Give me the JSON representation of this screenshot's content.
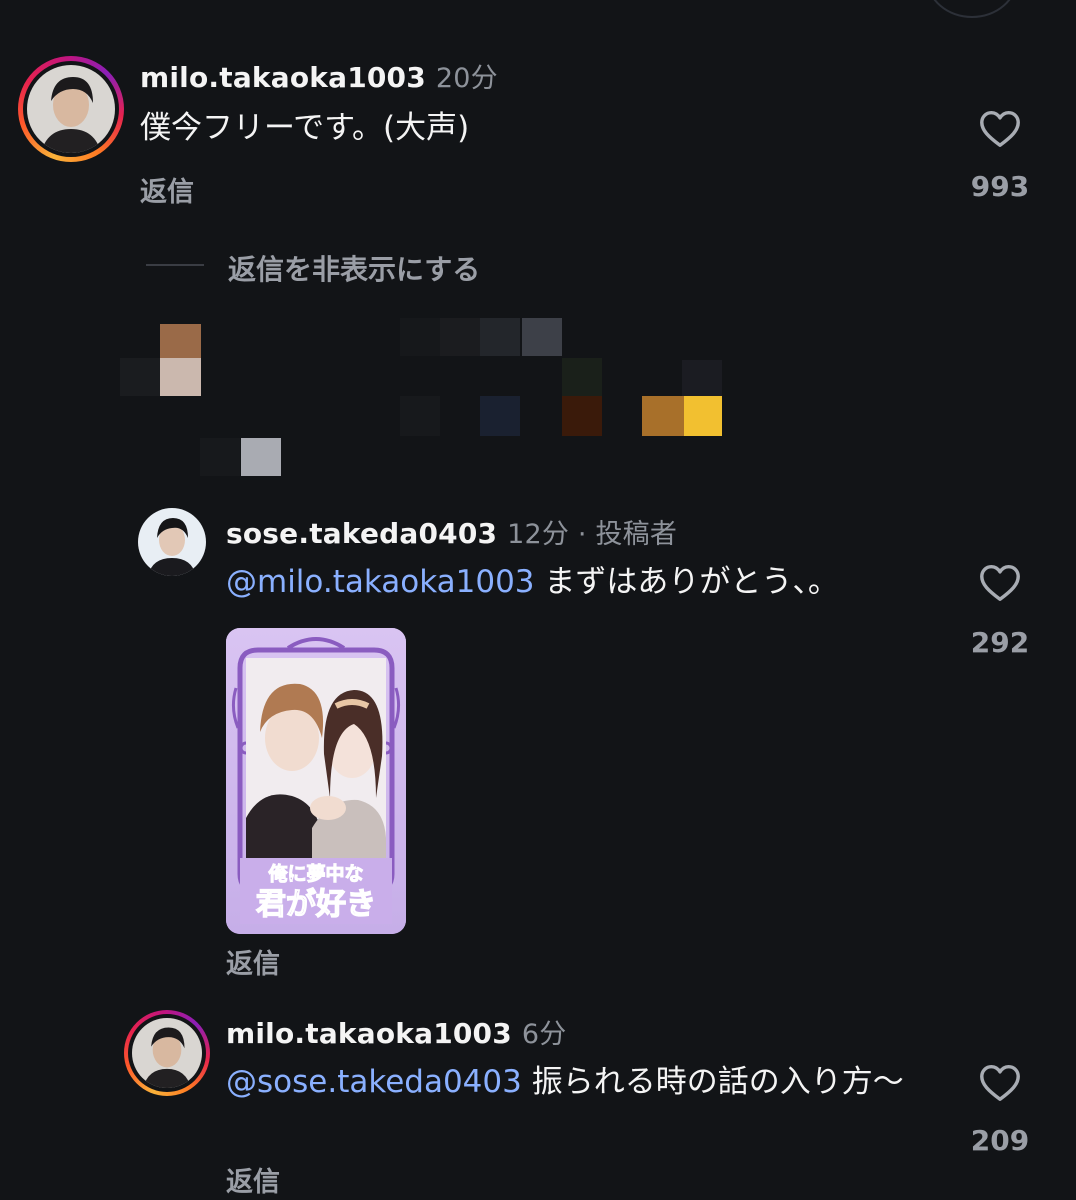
{
  "comment1": {
    "username": "milo.takaoka1003",
    "time": "20分",
    "text": "僕今フリーです。(大声)",
    "reply_label": "返信",
    "likes": "993"
  },
  "hide_replies": "返信を非表示にする",
  "reply1": {
    "username": "sose.takeda0403",
    "meta": "12分 · 投稿者",
    "mention": "@milo.takaoka1003",
    "text": " まずはありがとう、。",
    "reply_label": "返信",
    "likes": "292",
    "image_text_line1": "俺に夢中な",
    "image_text_line2": "君が好き"
  },
  "reply2": {
    "username": "milo.takaoka1003",
    "time": "6分",
    "mention": "@sose.takeda0403",
    "text": " 振られる時の話の入り方〜",
    "reply_label": "返信",
    "likes": "209"
  },
  "colors": {
    "background": "#121417",
    "mention": "#8ab0ff",
    "muted": "#9a9ea6"
  },
  "icons": [
    "heart-icon",
    "avatar"
  ]
}
